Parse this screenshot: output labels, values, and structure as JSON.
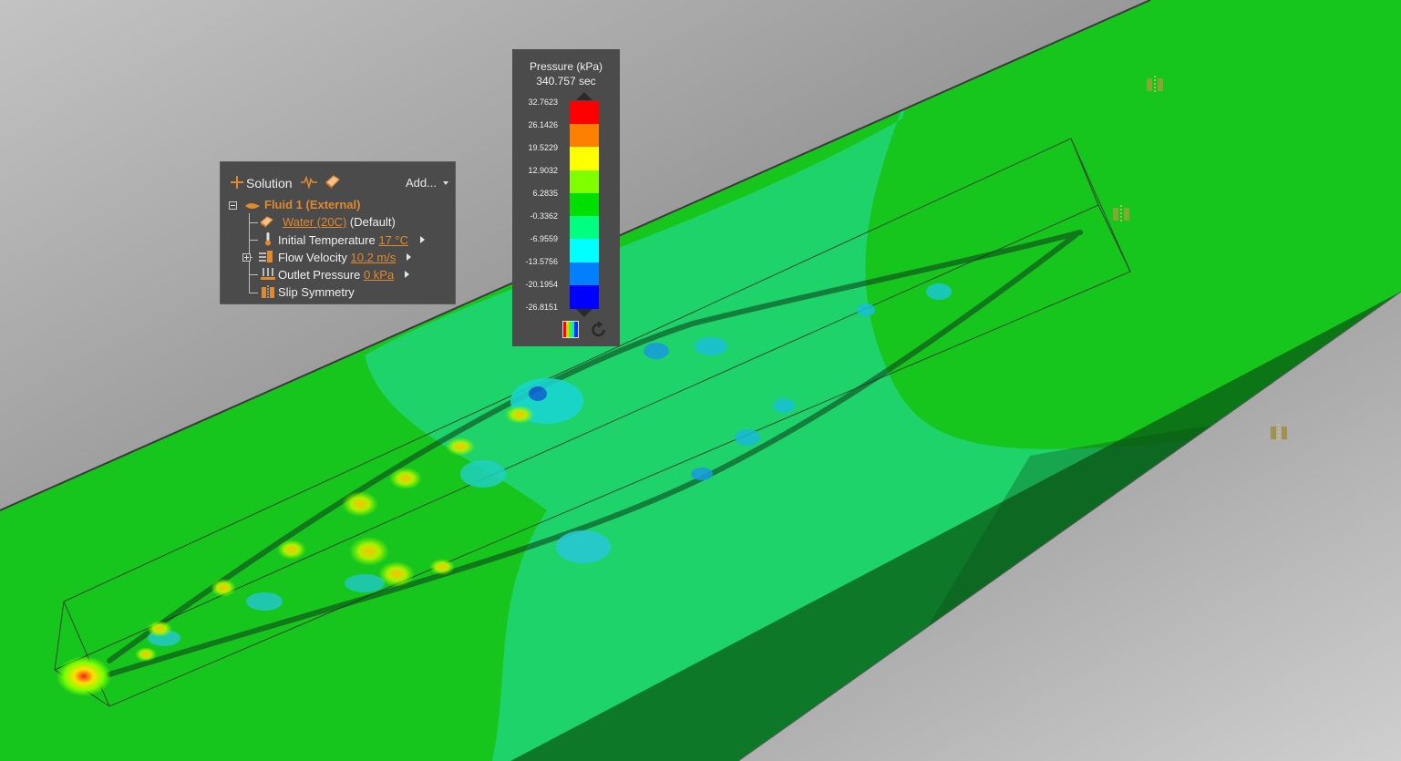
{
  "tree": {
    "header_label": "Solution",
    "add_label": "Add...",
    "icons": [
      "plus-icon",
      "probe-icon",
      "results-icon",
      "chevron-down-icon"
    ],
    "fluid": {
      "label": "Fluid 1 (External)"
    },
    "material": {
      "link": "Water (20C)",
      "suffix": " (Default)"
    },
    "initial_temperature": {
      "label": "Initial Temperature",
      "value": "17 °C"
    },
    "flow_velocity": {
      "label": "Flow Velocity",
      "value": "10.2 m/s"
    },
    "outlet_pressure": {
      "label": "Outlet Pressure",
      "value": "0 kPa"
    },
    "slip_symmetry": {
      "label": "Slip Symmetry"
    }
  },
  "legend": {
    "title": "Pressure (kPa)",
    "time": "340.757 sec",
    "ticks": [
      "32.7623",
      "26.1426",
      "19.5229",
      "12.9032",
      "6.2835",
      "-0.3362",
      "-6.9559",
      "-13.5756",
      "-20.1954",
      "-26.8151"
    ],
    "bands": [
      "#ff0000",
      "#ff7f00",
      "#ffff00",
      "#7fff00",
      "#00e000",
      "#00ff80",
      "#00ffff",
      "#007fff",
      "#0000ff"
    ]
  },
  "colors": {
    "accent": "#e0892f",
    "panel_bg": "#4b4b4b",
    "fluid_green": "#1ecf23"
  }
}
